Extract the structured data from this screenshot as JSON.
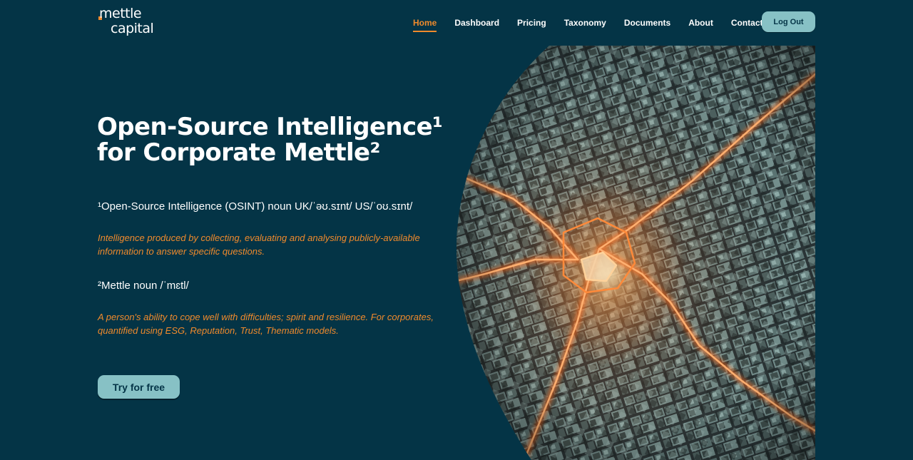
{
  "brand": {
    "logo_line1": "mettle",
    "logo_line2": "capital",
    "accent_color": "#f08a2c",
    "background_color": "#043446",
    "button_color": "#87c1c5"
  },
  "nav": {
    "items": [
      {
        "label": "Home",
        "active": true
      },
      {
        "label": "Dashboard",
        "active": false
      },
      {
        "label": "Pricing",
        "active": false
      },
      {
        "label": "Taxonomy",
        "active": false
      },
      {
        "label": "Documents",
        "active": false
      },
      {
        "label": "About",
        "active": false
      },
      {
        "label": "Contact",
        "active": false
      }
    ],
    "logout_label": "Log Out"
  },
  "hero": {
    "title_line1": "Open-Source Intelligence¹",
    "title_line2": "for Corporate Mettle²",
    "definitions": [
      {
        "term": "¹Open-Source Intelligence (OSINT) noun UK/ˈəʊ.sɪnt/ US/ˈoʊ.sɪnt/",
        "text": "Intelligence produced by collecting, evaluating and analysing publicly-available information to answer specific questions."
      },
      {
        "term": "²Mettle noun /ˈmɛtl/",
        "text": "A person's ability to cope well with difficulties; spirit and resilience. For corporates, quantified using ESG, Reputation, Trust, Thematic models."
      }
    ],
    "cta_label": "Try for free",
    "image_icon": "city-circuit-illustration"
  }
}
